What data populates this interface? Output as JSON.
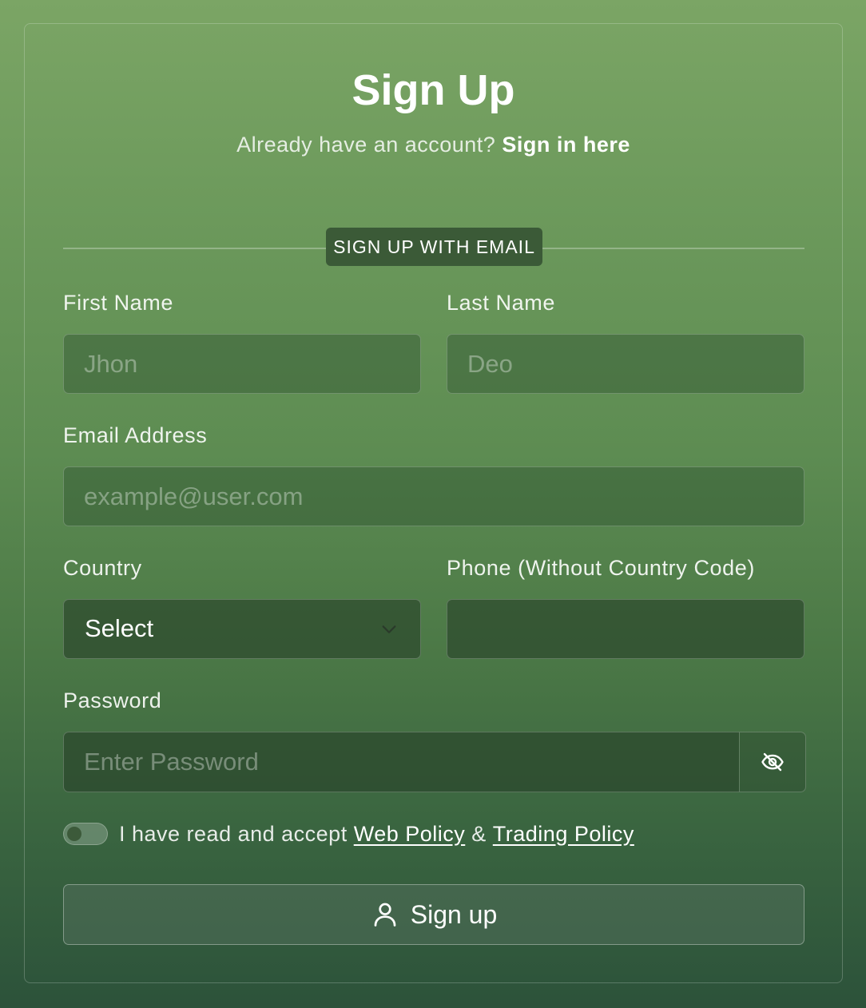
{
  "header": {
    "title": "Sign Up",
    "prompt": "Already have an account?",
    "signin_link": "Sign in here"
  },
  "divider_label": "SIGN UP WITH EMAIL",
  "fields": {
    "first_name": {
      "label": "First Name",
      "placeholder": "Jhon",
      "value": ""
    },
    "last_name": {
      "label": "Last Name",
      "placeholder": "Deo",
      "value": ""
    },
    "email": {
      "label": "Email Address",
      "placeholder": "example@user.com",
      "value": ""
    },
    "country": {
      "label": "Country",
      "selected": "Select"
    },
    "phone": {
      "label": "Phone (Without Country Code)",
      "placeholder": "",
      "value": ""
    },
    "password": {
      "label": "Password",
      "placeholder": "Enter Password",
      "value": ""
    }
  },
  "terms": {
    "text": "I have read and accept",
    "web_policy": "Web Policy",
    "ampersand": "&",
    "trading_policy": "Trading Policy",
    "checked": false
  },
  "submit": {
    "label": "Sign up",
    "icon": "user-icon"
  },
  "icons": {
    "password_toggle": "eye-off-icon",
    "country_dropdown": "chevron-down-icon"
  },
  "colors": {
    "background_top": "#7ba565",
    "background_bottom": "#2c523a",
    "divider_badge": "#3b5a37"
  }
}
